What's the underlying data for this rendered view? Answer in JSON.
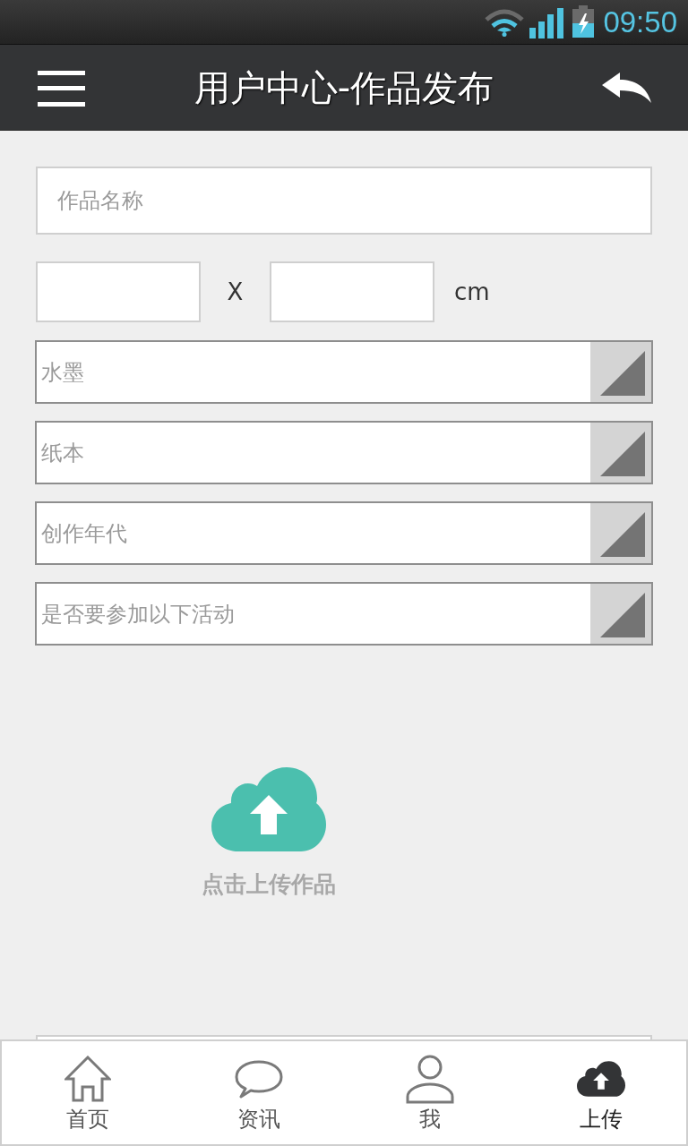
{
  "status_bar": {
    "time": "09:50"
  },
  "header": {
    "title": "用户中心-作品发布"
  },
  "form": {
    "name_field": {
      "placeholder": "作品名称"
    },
    "size": {
      "separator": "X",
      "unit": "cm"
    },
    "selects": [
      {
        "value": "水墨"
      },
      {
        "value": "纸本"
      },
      {
        "value": "创作年代"
      },
      {
        "value": "是否要参加以下活动"
      }
    ]
  },
  "upload": {
    "label": "点击上传作品"
  },
  "tab_bar": {
    "items": [
      {
        "kind": "home",
        "label": "首页",
        "selected": false
      },
      {
        "kind": "chat",
        "label": "资讯",
        "selected": false
      },
      {
        "kind": "person",
        "label": "我",
        "selected": false
      },
      {
        "kind": "upload",
        "label": "上传",
        "selected": true
      }
    ]
  }
}
